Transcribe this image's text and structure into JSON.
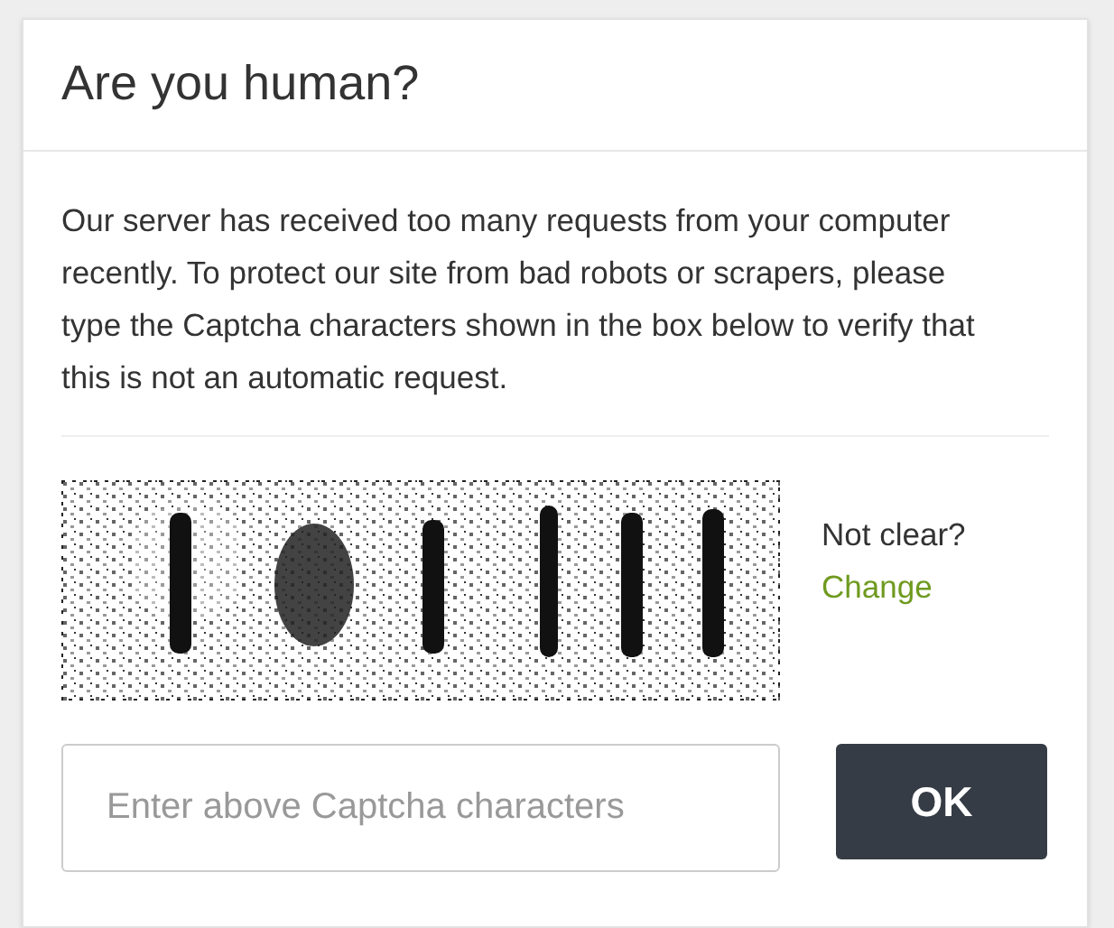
{
  "dialog": {
    "title": "Are you human?",
    "message": "Our server has received too many requests from your computer recently. To protect our site from bad robots or scrapers, please type the Captcha characters shown in the box below to verify that this is not an automatic request.",
    "captcha": {
      "kind": "picture",
      "hint": "Not clear?",
      "change_link": "Change"
    },
    "input": {
      "placeholder": "Enter above Captcha characters"
    },
    "button": "OK"
  }
}
